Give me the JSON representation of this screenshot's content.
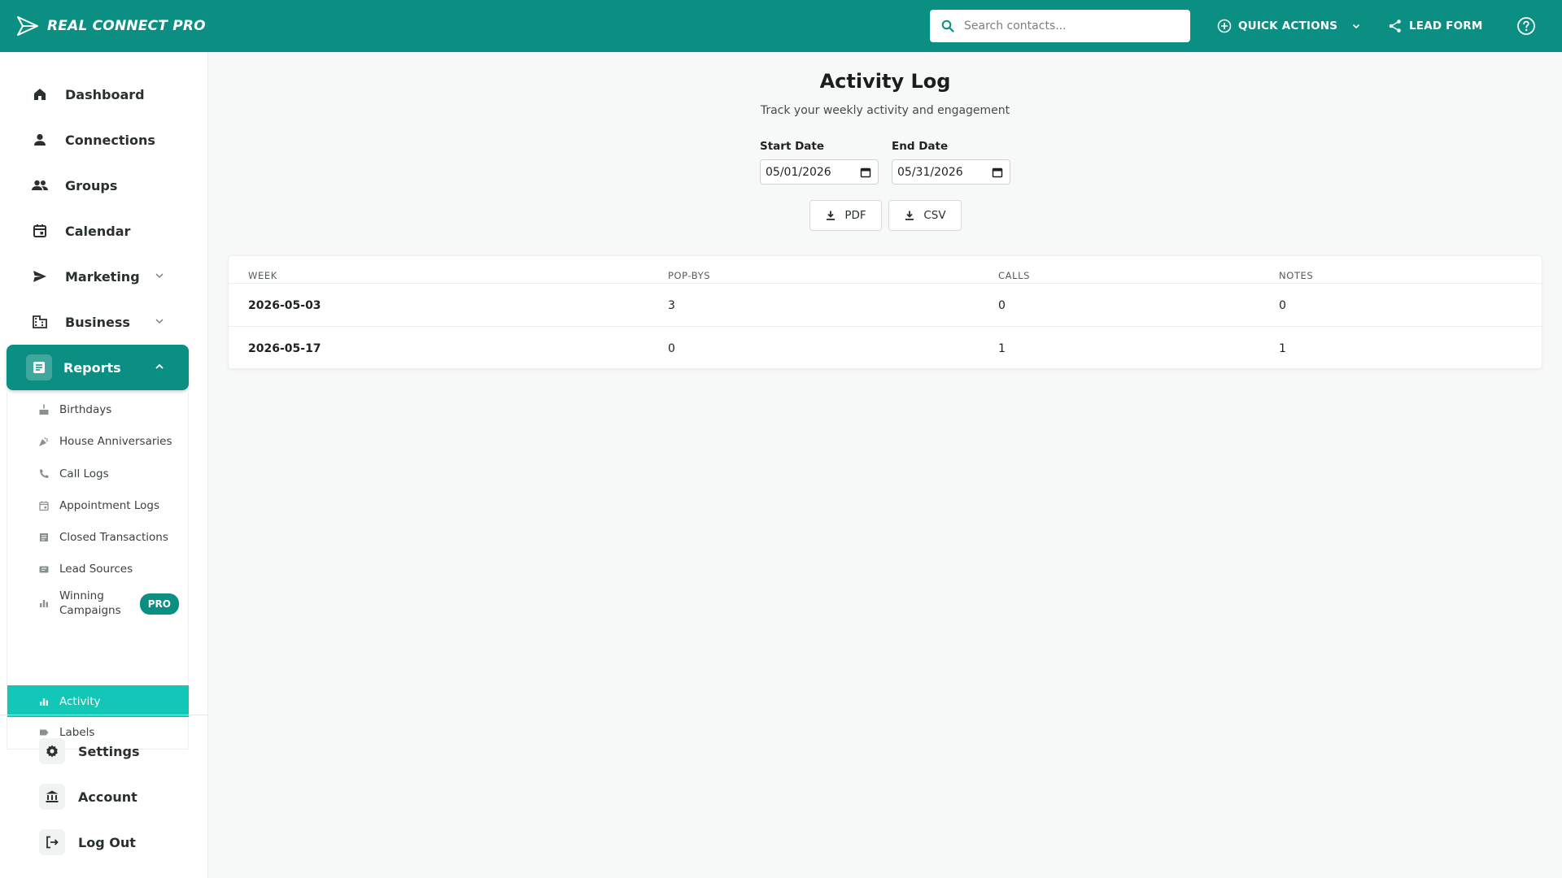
{
  "app": {
    "brand": "REAL CONNECT PRO"
  },
  "header": {
    "search_placeholder": "Search contacts...",
    "quick_actions_label": "QUICK ACTIONS",
    "lead_form_label": "LEAD FORM"
  },
  "sidebar": {
    "items": [
      {
        "label": "Dashboard"
      },
      {
        "label": "Connections"
      },
      {
        "label": "Groups"
      },
      {
        "label": "Calendar"
      },
      {
        "label": "Marketing"
      },
      {
        "label": "Business"
      },
      {
        "label": "Reports"
      }
    ],
    "report_items": [
      {
        "label": "Birthdays"
      },
      {
        "label": "House Anniversaries"
      },
      {
        "label": "Call Logs"
      },
      {
        "label": "Appointment Logs"
      },
      {
        "label": "Closed Transactions"
      },
      {
        "label": "Lead Sources"
      },
      {
        "label_line1": "Winning",
        "label_line2": "Campaigns",
        "badge": "PRO"
      },
      {
        "label": "Activity"
      },
      {
        "label": "Labels"
      }
    ],
    "bottom_items": [
      {
        "label": "Settings"
      },
      {
        "label": "Account"
      },
      {
        "label": "Log Out"
      }
    ]
  },
  "main": {
    "title": "Activity Log",
    "subtitle": "Track your weekly activity and engagement",
    "start_date_label": "Start Date",
    "start_date_value": "05/01/2026",
    "end_date_label": "End Date",
    "end_date_value": "05/31/2026",
    "pdf_label": "PDF",
    "csv_label": "CSV",
    "table": {
      "headers": [
        "WEEK",
        "POP-BYS",
        "CALLS",
        "NOTES"
      ],
      "rows": [
        [
          "2026-05-03",
          "3",
          "0",
          "0"
        ],
        [
          "2026-05-17",
          "0",
          "1",
          "1"
        ]
      ]
    }
  },
  "colors": {
    "brand": "#0b8f83",
    "active_sub": "#12c7b6"
  }
}
